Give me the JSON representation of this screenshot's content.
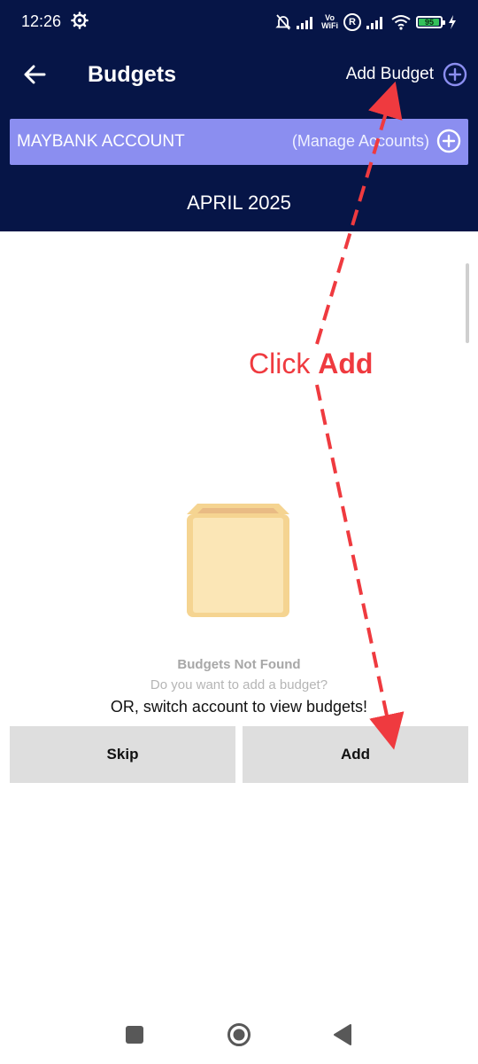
{
  "status_bar": {
    "time": "12:26",
    "vowifi_top": "Vo",
    "vowifi_bottom": "WiFi",
    "roaming": "R",
    "battery": "95",
    "battery_level": 0.95
  },
  "header": {
    "title": "Budgets",
    "add_budget_label": "Add Budget",
    "account_name": "MAYBANK ACCOUNT",
    "manage_accounts_label": "(Manage Accounts)",
    "month": "APRIL 2025"
  },
  "empty_state": {
    "title": "Budgets Not Found",
    "subtitle": "Do you want to add a budget?",
    "switch_text": "OR, switch account to view budgets!"
  },
  "actions": {
    "skip_label": "Skip",
    "add_label": "Add"
  },
  "annotation": {
    "prefix": "Click ",
    "emphasis": "Add"
  },
  "colors": {
    "header_bg": "#061547",
    "account_bar": "#8b8ef0",
    "accent_icon": "#8b8ef0",
    "annotation": "#ef3a3f",
    "button_bg": "#dedede"
  },
  "icons": {
    "back": "arrow-left-icon",
    "add_budget": "plus-circle-icon",
    "manage_accounts": "plus-circle-icon",
    "empty_box": "box-icon",
    "nav_recent": "square-icon",
    "nav_home": "circle-icon",
    "nav_back": "triangle-back-icon"
  }
}
